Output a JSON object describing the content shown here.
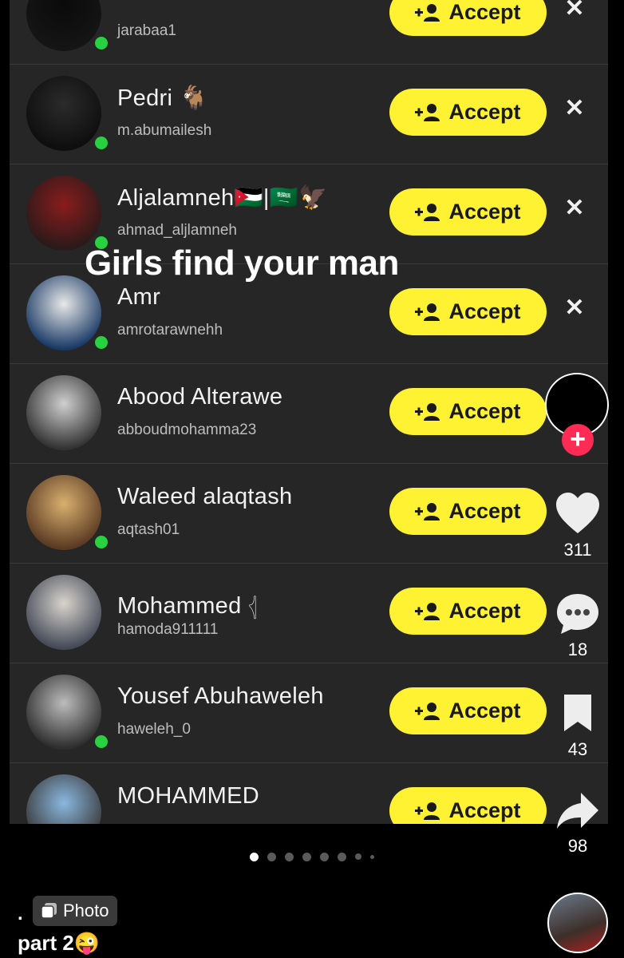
{
  "rows": [
    {
      "name": "",
      "username": "jarabaa1",
      "online": true,
      "has_dismiss": true,
      "accept_label": "Accept",
      "tone": [
        "#0a0a0a",
        "#151515"
      ]
    },
    {
      "name": "Pedri 🐐",
      "username": "m.abumailesh",
      "online": true,
      "has_dismiss": true,
      "accept_label": "Accept",
      "tone": [
        "#2b2b2b",
        "#0e0e0e"
      ]
    },
    {
      "name": "Aljalamneh🇯🇴|🇸🇦🦅",
      "username": "ahmad_aljlamneh",
      "online": true,
      "has_dismiss": true,
      "accept_label": "Accept",
      "tone": [
        "#8a1c1c",
        "#2a1a1a"
      ]
    },
    {
      "name": "Amr",
      "username": "amrotarawnehh",
      "online": true,
      "has_dismiss": true,
      "accept_label": "Accept",
      "tone": [
        "#e8e8e8",
        "#1a3a66"
      ]
    },
    {
      "name": "Abood Alterawe",
      "username": "abboudmohamma23",
      "online": false,
      "has_dismiss": false,
      "accept_label": "Accept",
      "tone": [
        "#cfcfcf",
        "#333333"
      ]
    },
    {
      "name": "Waleed alaqtash",
      "username": "aqtash01",
      "online": true,
      "has_dismiss": false,
      "accept_label": "Accept",
      "tone": [
        "#d8b070",
        "#5a3a22"
      ]
    },
    {
      "name": "Mohammed 𓂆",
      "username": "hamoda911111",
      "online": false,
      "has_dismiss": false,
      "accept_label": "Accept",
      "tone": [
        "#d9d4cc",
        "#444a58"
      ]
    },
    {
      "name": "Yousef Abuhaweleh",
      "username": "haweleh_0",
      "online": true,
      "has_dismiss": false,
      "accept_label": "Accept",
      "tone": [
        "#bcbcbc",
        "#2e2e2e"
      ]
    },
    {
      "name": "MOHAMMED",
      "username": "",
      "online": false,
      "has_dismiss": false,
      "accept_label": "Accept",
      "tone": [
        "#8ab8e0",
        "#3a3a3a"
      ]
    }
  ],
  "overlay_text": "Girls find your man",
  "rail": {
    "likes": "311",
    "comments": "18",
    "saves": "43",
    "shares": "98",
    "follow_plus": "+"
  },
  "carousel": {
    "count": 8,
    "active": 0
  },
  "bullet": ".",
  "photo_tag": "Photo",
  "caption": "part 2😜",
  "colors": {
    "accept_bg": "#fff233",
    "online": "#27d13f",
    "follow": "#fe2c55",
    "panel": "#262626"
  },
  "icons": [
    "add-friend-icon",
    "close-icon",
    "heart-icon",
    "comment-icon",
    "bookmark-icon",
    "share-icon",
    "photo-icon"
  ]
}
